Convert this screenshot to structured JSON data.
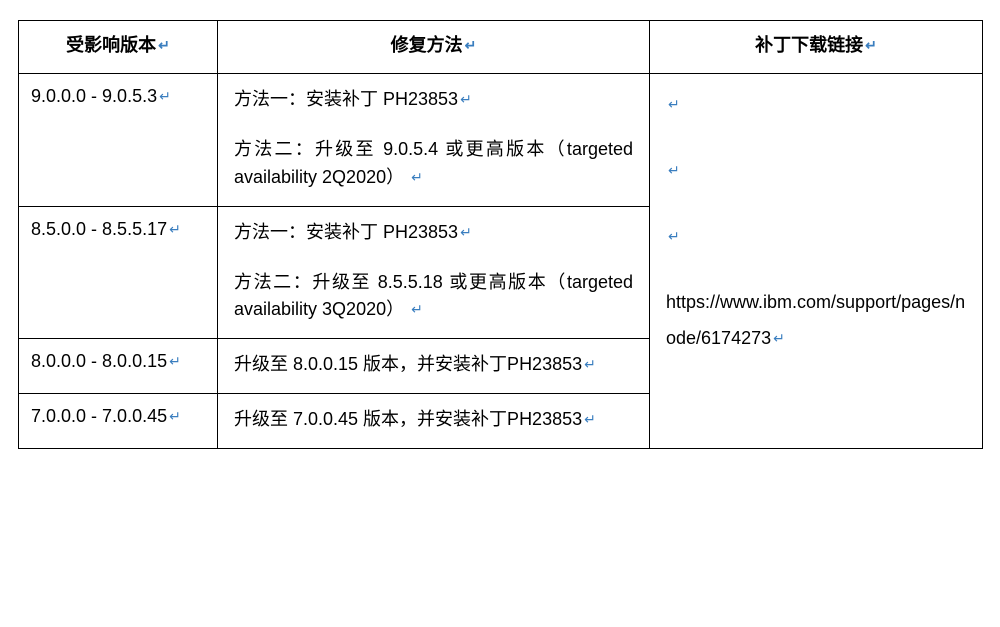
{
  "headers": {
    "col1": "受影响版本",
    "col2": "修复方法",
    "col3": "补丁下载链接"
  },
  "paragraph_mark": "↵",
  "rows": [
    {
      "version": "9.0.0.0 - 9.0.5.3",
      "fix_lines": [
        "方法一：安装补丁 PH23853",
        "方法二：升级至 9.0.5.4 或更高版本（targeted availability 2Q2020）"
      ]
    },
    {
      "version": "8.5.0.0 - 8.5.5.17",
      "fix_lines": [
        "方法一：安装补丁 PH23853",
        "方法二：升级至 8.5.5.18 或更高版本（targeted availability 3Q2020）"
      ]
    },
    {
      "version": "8.0.0.0 - 8.0.0.15",
      "fix_lines": [
        "升级至 8.0.0.15 版本，并安装补丁PH23853"
      ]
    },
    {
      "version": "7.0.0.0 - 7.0.0.45",
      "fix_lines": [
        "升级至 7.0.0.45 版本，并安装补丁PH23853"
      ]
    }
  ],
  "patch_link": "https://www.ibm.com/support/pages/node/6174273"
}
